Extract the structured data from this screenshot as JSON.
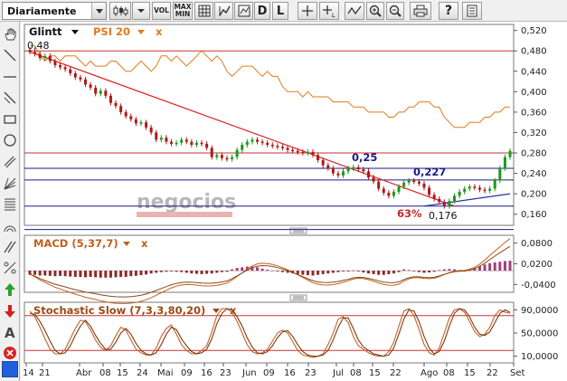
{
  "toolbar": {
    "period": "Diariamente",
    "vol_label": "VOL",
    "maxmin_label_1": "MAX",
    "maxmin_label_2": "MIN",
    "d_label": "D",
    "l_label": "L",
    "help_label": "?"
  },
  "legend": {
    "ticker": "Glintt",
    "indicator": "PSI 20",
    "close_symbol": "x"
  },
  "watermark": "negocios",
  "annotations": {
    "start_price": "0,48",
    "level_1": "0,25",
    "level_2": "0,227",
    "retracement": "63%",
    "low_price": "0,176"
  },
  "panels": {
    "macd": {
      "title": "MACD (5,37,7)",
      "close_symbol": "x"
    },
    "stochastic": {
      "title": "Stochastic Slow (7,3,3,80,20)",
      "close_symbol": "x"
    }
  },
  "price_axis": [
    "0,520",
    "0,480",
    "0,440",
    "0,400",
    "0,360",
    "0,320",
    "0,280",
    "0,240",
    "0,200",
    "0,160"
  ],
  "macd_axis": [
    "0,0800",
    "0,0200",
    "-0,0400"
  ],
  "stoch_axis": [
    "90,0000",
    "50,0000",
    "10,0000"
  ],
  "x_axis": [
    "14",
    "21",
    "Abr",
    "08",
    "15",
    "24",
    "Mai",
    "09",
    "16",
    "23",
    "Jun",
    "09",
    "16",
    "23",
    "Jul",
    "08",
    "15",
    "22",
    "Ago",
    "08",
    "15",
    "22",
    "Set"
  ],
  "colors": {
    "up_candle": "#1a9a1a",
    "down_candle": "#b01818",
    "trend_down": "#dd2222",
    "trend_up": "#2233aa",
    "psi20_line": "#e07b1e",
    "macd_line": "#c0601a",
    "hline_red": "#c83232",
    "hline_blue": "#1a1a8a"
  },
  "chart_data": [
    {
      "type": "candlestick",
      "name": "Glintt",
      "ylim": [
        0.14,
        0.53
      ],
      "y_ticks": [
        0.52,
        0.48,
        0.44,
        0.4,
        0.36,
        0.32,
        0.28,
        0.24,
        0.2,
        0.16
      ],
      "close": [
        0.478,
        0.474,
        0.466,
        0.47,
        0.46,
        0.452,
        0.448,
        0.444,
        0.436,
        0.428,
        0.424,
        0.414,
        0.408,
        0.396,
        0.402,
        0.392,
        0.378,
        0.372,
        0.36,
        0.352,
        0.346,
        0.338,
        0.34,
        0.33,
        0.32,
        0.306,
        0.31,
        0.302,
        0.298,
        0.3,
        0.306,
        0.302,
        0.296,
        0.3,
        0.298,
        0.29,
        0.272,
        0.276,
        0.27,
        0.268,
        0.272,
        0.286,
        0.296,
        0.302,
        0.306,
        0.302,
        0.3,
        0.296,
        0.294,
        0.292,
        0.29,
        0.286,
        0.284,
        0.282,
        0.28,
        0.282,
        0.276,
        0.266,
        0.256,
        0.25,
        0.24,
        0.236,
        0.244,
        0.25,
        0.252,
        0.248,
        0.244,
        0.232,
        0.224,
        0.21,
        0.202,
        0.196,
        0.204,
        0.214,
        0.222,
        0.226,
        0.224,
        0.22,
        0.212,
        0.198,
        0.19,
        0.184,
        0.176,
        0.186,
        0.196,
        0.204,
        0.21,
        0.214,
        0.212,
        0.208,
        0.206,
        0.21,
        0.226,
        0.25,
        0.272,
        0.284
      ],
      "overlay": {
        "name": "PSI 20",
        "relative_values": [
          0.49,
          0.49,
          0.47,
          0.46,
          0.47,
          0.47,
          0.46,
          0.47,
          0.47,
          0.47,
          0.46,
          0.45,
          0.46,
          0.45,
          0.45,
          0.45,
          0.46,
          0.46,
          0.45,
          0.44,
          0.44,
          0.45,
          0.46,
          0.45,
          0.44,
          0.45,
          0.47,
          0.47,
          0.46,
          0.47,
          0.46,
          0.45,
          0.46,
          0.47,
          0.48,
          0.47,
          0.46,
          0.47,
          0.46,
          0.44,
          0.43,
          0.44,
          0.45,
          0.45,
          0.45,
          0.44,
          0.43,
          0.44,
          0.43,
          0.43,
          0.41,
          0.4,
          0.4,
          0.4,
          0.39,
          0.4,
          0.39,
          0.39,
          0.39,
          0.39,
          0.38,
          0.38,
          0.38,
          0.38,
          0.37,
          0.37,
          0.37,
          0.36,
          0.36,
          0.36,
          0.36,
          0.35,
          0.35,
          0.36,
          0.36,
          0.37,
          0.37,
          0.38,
          0.38,
          0.38,
          0.37,
          0.37,
          0.35,
          0.34,
          0.33,
          0.33,
          0.33,
          0.34,
          0.34,
          0.34,
          0.35,
          0.35,
          0.36,
          0.36,
          0.37,
          0.37
        ]
      },
      "horizontal_lines": [
        {
          "value": 0.48,
          "color": "#c83232"
        },
        {
          "value": 0.28,
          "color": "#c83232"
        },
        {
          "value": 0.25,
          "color": "#1a1a8a"
        },
        {
          "value": 0.227,
          "color": "#1a1a8a"
        },
        {
          "value": 0.176,
          "color": "#1a1a8a"
        },
        {
          "value": 0.13,
          "color": "#1a1a8a"
        }
      ],
      "trend_lines": [
        {
          "from": [
            0,
            0.478
          ],
          "to": [
            84,
            0.176
          ],
          "color": "#dd2222"
        },
        {
          "from": [
            78,
            0.176
          ],
          "to": [
            95,
            0.2
          ],
          "color": "#2233aa"
        }
      ]
    },
    {
      "type": "bar",
      "name": "MACD (5,37,7)",
      "ylim": [
        -0.06,
        0.1
      ],
      "histogram": [
        -0.012,
        -0.012,
        -0.014,
        -0.014,
        -0.015,
        -0.016,
        -0.015,
        -0.016,
        -0.017,
        -0.018,
        -0.018,
        -0.019,
        -0.018,
        -0.019,
        -0.02,
        -0.02,
        -0.02,
        -0.019,
        -0.018,
        -0.018,
        -0.016,
        -0.015,
        -0.013,
        -0.011,
        -0.008,
        -0.006,
        -0.004,
        -0.003,
        -0.002,
        -0.003,
        -0.004,
        -0.006,
        -0.008,
        -0.009,
        -0.01,
        -0.009,
        -0.008,
        -0.006,
        -0.004,
        -0.003,
        0.004,
        0.008,
        0.01,
        0.012,
        0.012,
        0.01,
        0.006,
        0.003,
        0.001,
        -0.002,
        -0.004,
        -0.006,
        -0.008,
        -0.01,
        -0.012,
        -0.013,
        -0.014,
        -0.012,
        -0.01,
        -0.008,
        -0.006,
        -0.004,
        -0.002,
        -0.001,
        0.001,
        -0.002,
        -0.005,
        -0.008,
        -0.01,
        -0.012,
        -0.012,
        -0.01,
        -0.008,
        -0.004,
        0.004,
        0.002,
        0.0,
        -0.004,
        -0.006,
        -0.005,
        -0.003,
        0.002,
        0.004,
        0.005,
        0.004,
        0.002,
        0.001,
        0.004,
        0.008,
        0.013,
        0.018,
        0.022,
        0.024,
        0.026,
        0.028,
        0.029
      ]
    },
    {
      "type": "line",
      "name": "Stochastic Slow (7,3,3,80,20)",
      "ylim": [
        0,
        100
      ],
      "y_ticks": [
        90,
        50,
        10
      ],
      "k": [
        88,
        78,
        60,
        40,
        22,
        14,
        14,
        22,
        40,
        58,
        72,
        70,
        55,
        38,
        25,
        20,
        28,
        45,
        60,
        55,
        38,
        22,
        16,
        12,
        12,
        24,
        44,
        58,
        64,
        48,
        30,
        20,
        14,
        14,
        20,
        28,
        52,
        80,
        92,
        92,
        86,
        70,
        50,
        30,
        18,
        14,
        16,
        22,
        36,
        50,
        55,
        50,
        35,
        20,
        12,
        10,
        8,
        10,
        14,
        30,
        50,
        74,
        78,
        68,
        44,
        28,
        22,
        16,
        12,
        10,
        10,
        18,
        34,
        62,
        88,
        92,
        80,
        56,
        30,
        16,
        12,
        24,
        50,
        76,
        90,
        92,
        86,
        70,
        52,
        44,
        48,
        60,
        80,
        90,
        86,
        84
      ],
      "d": [
        84,
        82,
        70,
        54,
        36,
        20,
        14,
        16,
        28,
        46,
        62,
        72,
        62,
        46,
        32,
        22,
        22,
        34,
        50,
        58,
        48,
        32,
        20,
        14,
        12,
        16,
        30,
        48,
        60,
        56,
        40,
        28,
        18,
        14,
        16,
        22,
        40,
        66,
        84,
        92,
        90,
        78,
        62,
        42,
        26,
        16,
        14,
        18,
        28,
        42,
        52,
        54,
        44,
        30,
        18,
        12,
        10,
        10,
        12,
        20,
        38,
        60,
        76,
        76,
        58,
        38,
        26,
        20,
        14,
        12,
        10,
        12,
        24,
        48,
        74,
        90,
        88,
        70,
        44,
        24,
        14,
        18,
        36,
        62,
        84,
        92,
        90,
        78,
        60,
        48,
        46,
        52,
        68,
        84,
        90,
        86
      ]
    }
  ]
}
